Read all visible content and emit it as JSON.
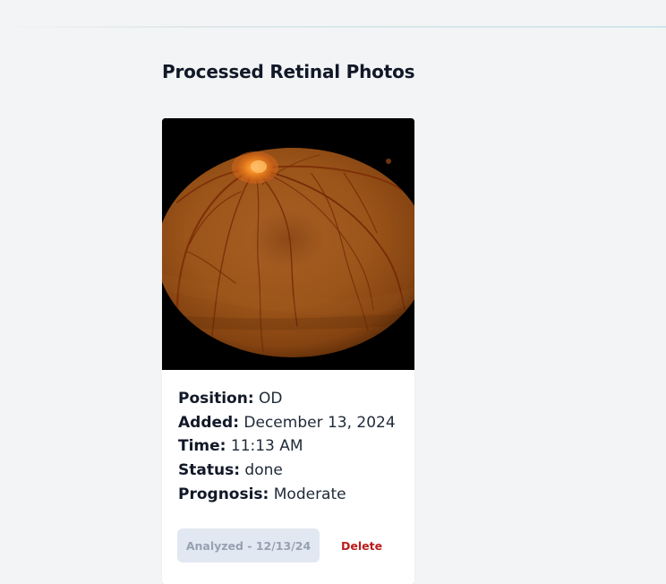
{
  "page": {
    "section_title": "Processed Retinal Photos"
  },
  "photos": [
    {
      "fields": [
        {
          "label": "Position:",
          "value": "OD"
        },
        {
          "label": "Added:",
          "value": "December 13, 2024"
        },
        {
          "label": "Time:",
          "value": "11:13 AM"
        },
        {
          "label": "Status:",
          "value": "done"
        },
        {
          "label": "Prognosis:",
          "value": "Moderate"
        }
      ],
      "analyzed_label": "Analyzed - 12/13/24",
      "delete_label": "Delete"
    }
  ],
  "colors": {
    "background": "#f3f4f6",
    "card": "#ffffff",
    "analyzed_button_bg": "#e2e8f2",
    "analyzed_button_text": "#97a1b2",
    "delete_text": "#b91c1c",
    "fundus_base": "#a35a1f",
    "optic_disc": "#f37f20"
  }
}
